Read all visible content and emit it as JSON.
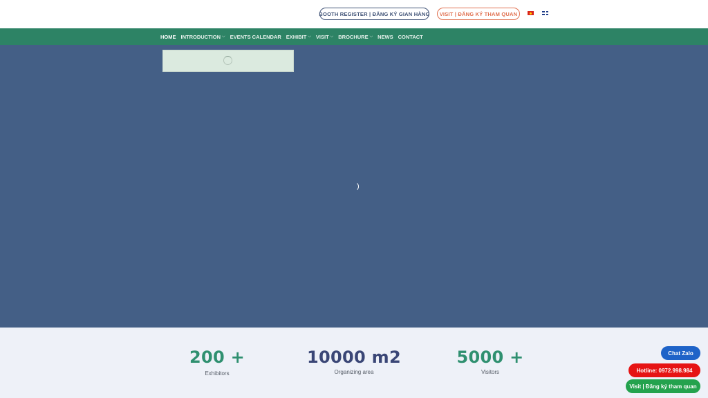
{
  "topbar": {
    "booth_register": "BOOTH REGISTER | ĐĂNG KÝ GIAN HÀNG",
    "visit_register": "VISIT | ĐĂNG KÝ THAM QUAN"
  },
  "nav": {
    "items": [
      {
        "label": "HOME",
        "dropdown": false
      },
      {
        "label": "INTRODUCTION",
        "dropdown": true
      },
      {
        "label": "EVENTS CALENDAR",
        "dropdown": false
      },
      {
        "label": "EXHIBIT",
        "dropdown": true
      },
      {
        "label": "VISIT",
        "dropdown": true
      },
      {
        "label": "BROCHURE",
        "dropdown": true
      },
      {
        "label": "NEWS",
        "dropdown": false
      },
      {
        "label": "CONTACT",
        "dropdown": false
      }
    ],
    "chevron": "⌵"
  },
  "stats": [
    {
      "value": "200 +",
      "label": "Exhibitors"
    },
    {
      "value": "10000 m2",
      "label": "Organizing area"
    },
    {
      "value": "5000 +",
      "label": "Visitors"
    }
  ],
  "floating": {
    "chat_zalo": "Chat Zalo",
    "hotline": "Hotline: 0972.998.984",
    "visit": "Visit | Đăng ký tham quan"
  },
  "colors": {
    "nav_bg": "#2d8365",
    "hero_bg": "#445f86",
    "stats_bg": "#eef1f8",
    "booth_accent": "#3f5276",
    "visit_accent": "#e0704f",
    "zalo": "#1e63c8",
    "hotline": "#e61414",
    "visit_btn": "#23a24d"
  },
  "icons": [
    "vietnam-flag-icon",
    "uk-flag-icon",
    "chevron-down-icon",
    "loading-spinner-icon"
  ]
}
